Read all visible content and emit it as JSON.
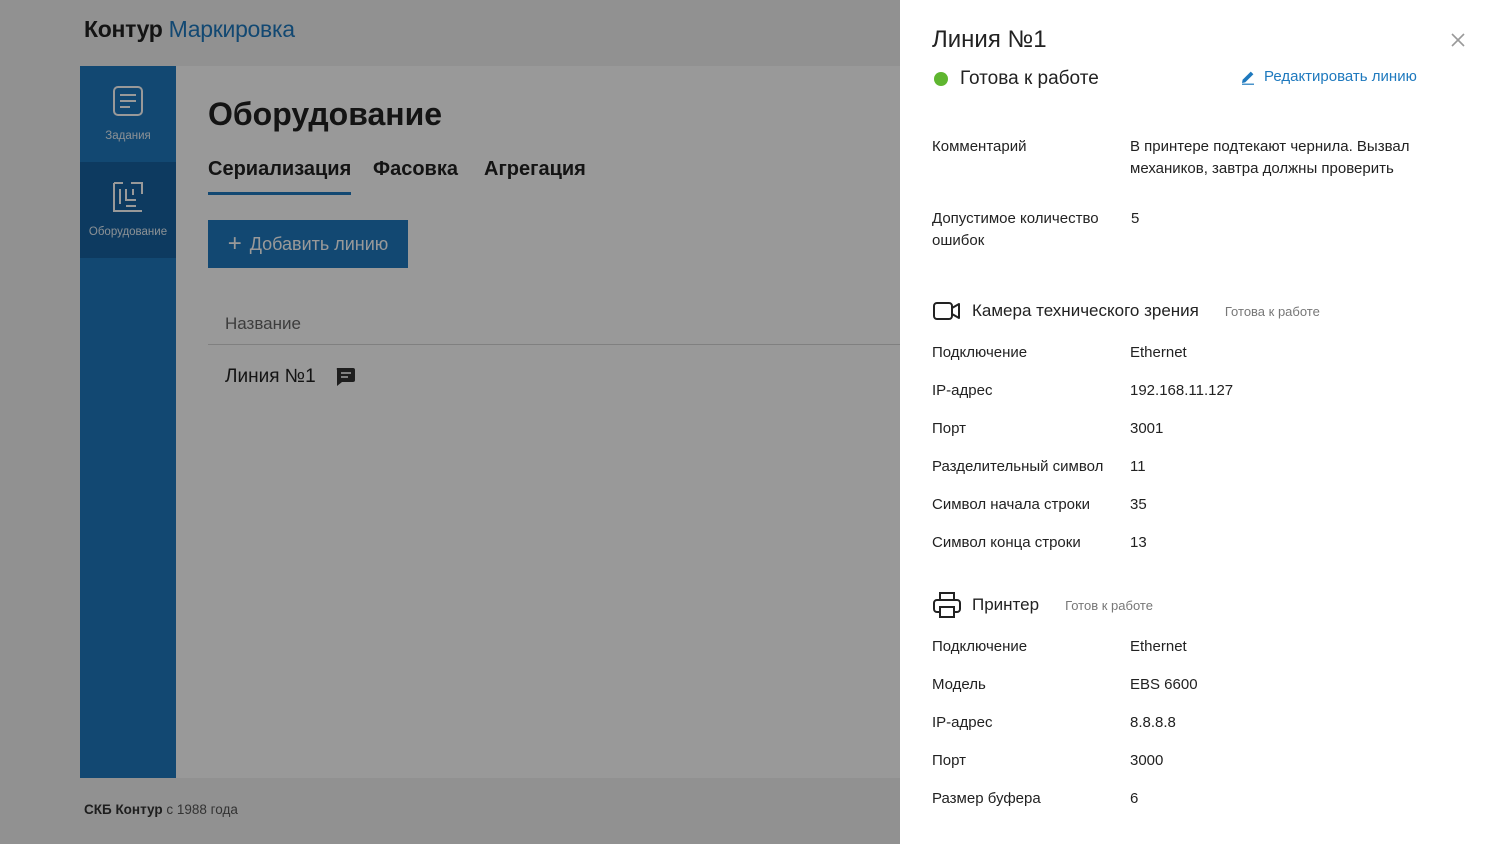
{
  "app": {
    "logo_brand": "Контур",
    "logo_product": "Маркировка",
    "sidebar": [
      {
        "label": "Задания",
        "icon": "tasks-icon"
      },
      {
        "label": "Оборудование",
        "icon": "equipment-icon"
      }
    ],
    "page_title": "Оборудование",
    "tabs": [
      "Сериализация",
      "Фасовка",
      "Агрегация"
    ],
    "active_tab": "Сериализация",
    "add_button": "Добавить линию",
    "table": {
      "header": "Название",
      "rows": [
        {
          "name": "Линия №1",
          "has_comment": true
        }
      ]
    },
    "footer_brand": "СКБ Контур",
    "footer_text": " с 1988 года"
  },
  "panel": {
    "title": "Линия №1",
    "status": "Готова к работе",
    "status_color": "#5fb630",
    "edit_link": "Редактировать линию",
    "comment_label": "Комментарий",
    "comment_value": "В принтере подтекают чернила. Вызвал механиков, завтра должны проверить",
    "errors_label": "Допустимое количество ошибок",
    "errors_value": "5",
    "camera": {
      "title": "Камера технического зрения",
      "status": "Готова к работе",
      "fields": [
        {
          "label": "Подключение",
          "value": "Ethernet"
        },
        {
          "label": "IP-адрес",
          "value": "192.168.11.127"
        },
        {
          "label": "Порт",
          "value": "3001"
        },
        {
          "label": "Разделительный символ",
          "value": "11"
        },
        {
          "label": "Символ начала строки",
          "value": "35"
        },
        {
          "label": "Символ конца строки",
          "value": "13"
        }
      ]
    },
    "printer": {
      "title": "Принтер",
      "status": "Готов к работе",
      "fields": [
        {
          "label": "Подключение",
          "value": "Ethernet"
        },
        {
          "label": "Модель",
          "value": "EBS 6600"
        },
        {
          "label": "IP-адрес",
          "value": "8.8.8.8"
        },
        {
          "label": "Порт",
          "value": "3000"
        },
        {
          "label": "Размер буфера",
          "value": "6"
        }
      ]
    }
  },
  "colors": {
    "accent": "#1e79be",
    "sidebar_active": "#1762a0",
    "ok": "#5fb630"
  }
}
